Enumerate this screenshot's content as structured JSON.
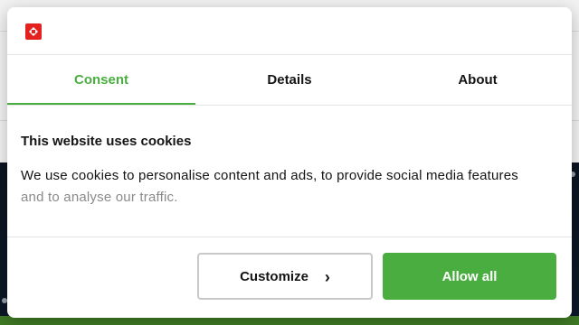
{
  "dialog": {
    "tabs": [
      {
        "label": "Consent",
        "active": true
      },
      {
        "label": "Details",
        "active": false
      },
      {
        "label": "About",
        "active": false
      }
    ],
    "title": "This website uses cookies",
    "body_main": "We use cookies to personalise content and ads, to provide social media features",
    "body_faded": "and to analyse our traffic.",
    "buttons": {
      "customize": "Customize",
      "customize_icon": "›",
      "allow_all": "Allow all"
    }
  },
  "colors": {
    "accent": "#4aad40",
    "brand": "#e3211f",
    "text": "#141414"
  }
}
